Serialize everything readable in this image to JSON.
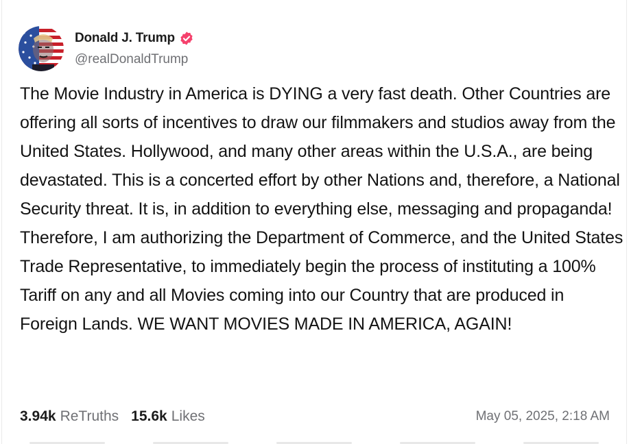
{
  "post": {
    "author": {
      "display_name": "Donald J. Trump",
      "handle": "@realDonaldTrump",
      "verified": true,
      "verified_color": "#f5416c"
    },
    "text": "The Movie Industry in America is DYING a very fast death. Other Countries are offering all sorts of incentives to draw our filmmakers and studios away from the United States. Hollywood, and many other areas within the U.S.A., are being devastated. This is a concerted effort by other Nations and, therefore, a National Security threat. It is, in addition to everything else, messaging and propaganda! Therefore, I am authorizing the Department of Commerce, and the United States Trade Representative, to immediately begin the process of instituting a 100% Tariff on any and all Movies coming into our Country that are produced in Foreign Lands. WE WANT MOVIES MADE IN AMERICA, AGAIN!",
    "stats": {
      "retruths_count": "3.94k",
      "retruths_label": "ReTruths",
      "likes_count": "15.6k",
      "likes_label": "Likes"
    },
    "timestamp": "May 05, 2025, 2:18 AM"
  }
}
